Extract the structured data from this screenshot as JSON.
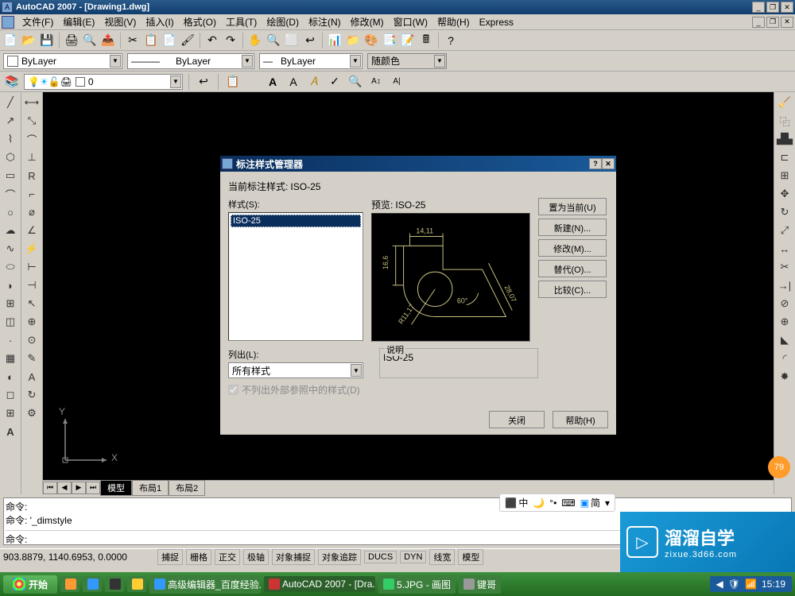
{
  "app": {
    "title": "AutoCAD 2007 - [Drawing1.dwg]"
  },
  "menu": {
    "items": [
      "文件(F)",
      "编辑(E)",
      "视图(V)",
      "插入(I)",
      "格式(O)",
      "工具(T)",
      "绘图(D)",
      "标注(N)",
      "修改(M)",
      "窗口(W)",
      "帮助(H)",
      "Express"
    ]
  },
  "props": {
    "color": "ByLayer",
    "linetype": "ByLayer",
    "lineweight": "ByLayer",
    "plot": "随颜色"
  },
  "layer": {
    "current": "0"
  },
  "tabs": {
    "items": [
      "模型",
      "布局1",
      "布局2"
    ],
    "active": 0
  },
  "cmd": {
    "lines": [
      "命令:",
      "命令: '_dimstyle"
    ],
    "prompt": "命令:"
  },
  "status": {
    "coords": "903.8879, 1140.6953, 0.0000",
    "buttons": [
      "捕捉",
      "栅格",
      "正交",
      "极轴",
      "对象捕捉",
      "对象追踪",
      "DUCS",
      "DYN",
      "线宽",
      "模型"
    ]
  },
  "taskbar": {
    "start": "开始",
    "items": [
      "",
      "",
      "",
      "",
      "高级编辑器_百度经验...",
      "AutoCAD 2007 - [Dra...",
      "5.JPG - 画图",
      "键哥"
    ],
    "time": "15:19"
  },
  "dialog": {
    "title": "标注样式管理器",
    "current_label": "当前标注样式:",
    "current_value": "ISO-25",
    "styles_label": "样式(S):",
    "style_item": "ISO-25",
    "preview_label": "预览:",
    "preview_value": "ISO-25",
    "list_label": "列出(L):",
    "list_value": "所有样式",
    "ext_ref": "不列出外部参照中的样式(D)",
    "desc_label": "说明",
    "desc_value": "ISO-25",
    "buttons": {
      "set_current": "置为当前(U)",
      "new": "新建(N)...",
      "modify": "修改(M)...",
      "override": "替代(O)...",
      "compare": "比较(C)..."
    },
    "close": "关闭",
    "help": "帮助(H)",
    "preview_dims": {
      "w": "14,11",
      "h": "16,6",
      "diag": "28,07",
      "ang": "60°",
      "rad": "R11,17"
    }
  },
  "watermark": {
    "big": "溜溜自学",
    "small": "zixue.3d66.com"
  },
  "badge": "79",
  "ime": {
    "a": "中",
    "b": "简"
  },
  "ucs": {
    "x": "X",
    "y": "Y"
  }
}
